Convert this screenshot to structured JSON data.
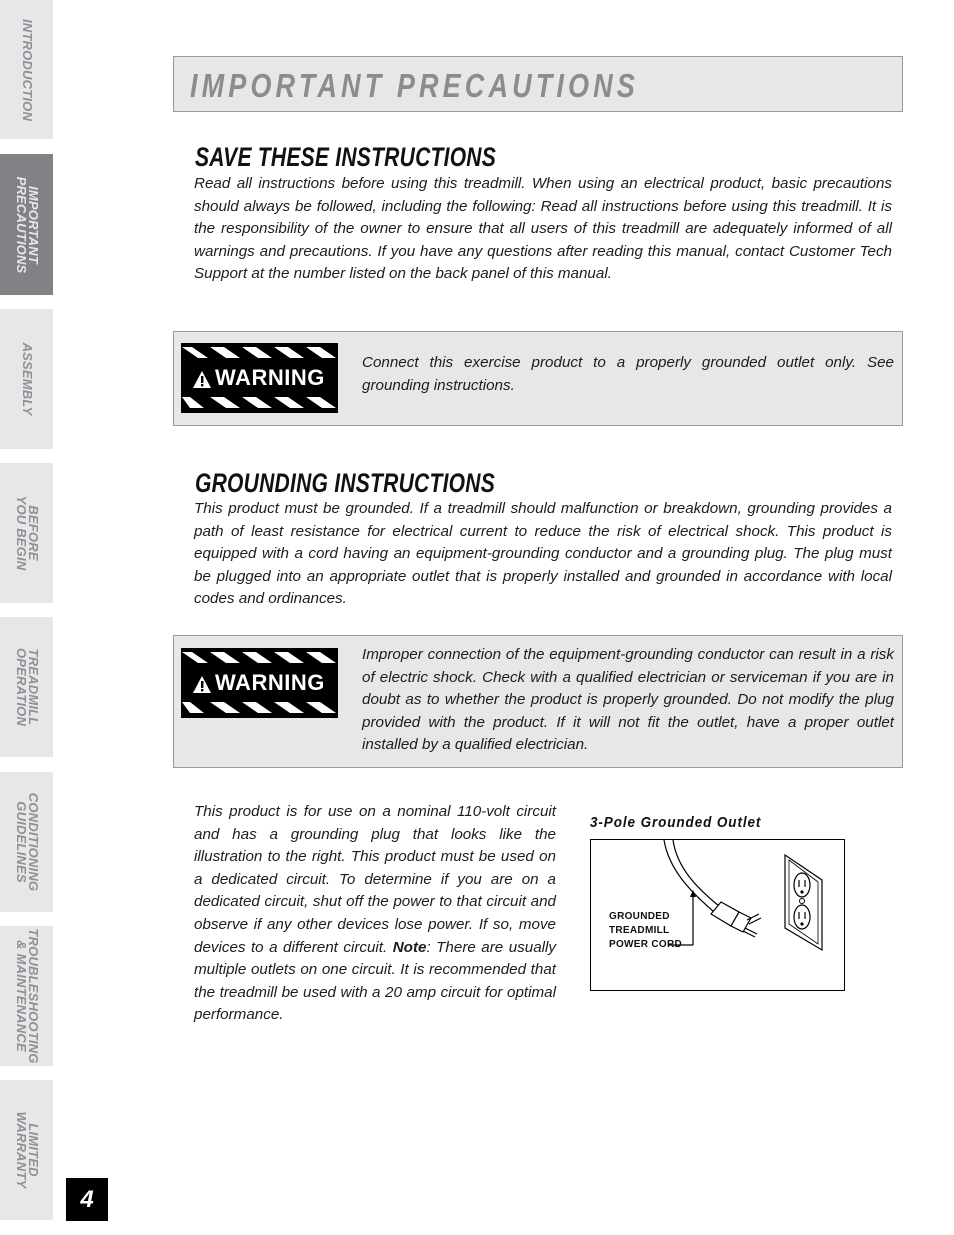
{
  "sidebar": {
    "tabs": [
      {
        "lines": [
          "INTRODUCTION"
        ],
        "active": false
      },
      {
        "lines": [
          "IMPORTANT",
          "PRECAUTIONS"
        ],
        "active": true
      },
      {
        "lines": [
          "ASSEMBLY"
        ],
        "active": false
      },
      {
        "lines": [
          "BEFORE",
          "YOU BEGIN"
        ],
        "active": false
      },
      {
        "lines": [
          "TREADMILL",
          "OPERATION"
        ],
        "active": false
      },
      {
        "lines": [
          "CONDITIONING",
          "GUIDELINES"
        ],
        "active": false
      },
      {
        "lines": [
          "TROUBLESHOOTING",
          "& MAINTENANCE"
        ],
        "active": false
      },
      {
        "lines": [
          "LIMITED",
          "WARRANTY"
        ],
        "active": false
      }
    ]
  },
  "page_title": "IMPORTANT PRECAUTIONS",
  "page_number": "4",
  "save_section": {
    "heading": "SAVE THESE INSTRUCTIONS",
    "body": "Read all instructions before using this treadmill. When using an electrical product, basic precautions should always be followed, including the following: Read all instructions before using this treadmill. It is the responsibility of the owner to ensure that all users of this treadmill are adequately informed of all warnings and precautions. If you have any questions after reading this manual, contact Customer Tech Support at the number listed on the back panel of this manual."
  },
  "warning_1": {
    "sign_label": "WARNING",
    "text": "Connect this exercise product to a properly grounded outlet only. See grounding instructions."
  },
  "grounding_section": {
    "heading": "GROUNDING INSTRUCTIONS",
    "body": "This product must be grounded. If a treadmill should malfunction or breakdown, grounding provides a path of least resistance for electrical current to reduce the risk of electrical shock. This product is equipped with a cord having an equipment-grounding conductor and a grounding plug. The plug must be plugged into an appropriate outlet that is properly installed and grounded in accordance with local codes and ordinances."
  },
  "warning_2": {
    "sign_label": "WARNING",
    "text": "Improper connection of the equipment-grounding conductor can result in a risk of electric shock. Check with a qualified electrician or serviceman if you are in doubt as to whether the product is properly grounded. Do not modify the plug provided with the product. If it will not fit the outlet, have a proper outlet installed by a qualified electrician."
  },
  "circuit_section": {
    "body_before_note": "This product is for use on a nominal 110-volt circuit and has a grounding plug that looks like the illustration to the right. This product must be used on a dedicated circuit. To determine if you are on a dedicated circuit, shut off the power to that circuit and observe if any other devices lose power. If so, move devices to a different circuit. ",
    "note_label": "Note",
    "body_after_note": ": There are usually multiple outlets on one circuit. It is recommended that the treadmill be used with a 20 amp circuit for optimal performance."
  },
  "figure": {
    "title": "3-Pole Grounded Outlet",
    "label_lines": [
      "GROUNDED",
      "TREADMILL",
      "POWER CORD"
    ]
  },
  "colors": {
    "tab_bg": "#e6e7e8",
    "tab_active_bg": "#808285",
    "title_text": "#8a8c8e",
    "box_bg": "#e6e7e8"
  }
}
